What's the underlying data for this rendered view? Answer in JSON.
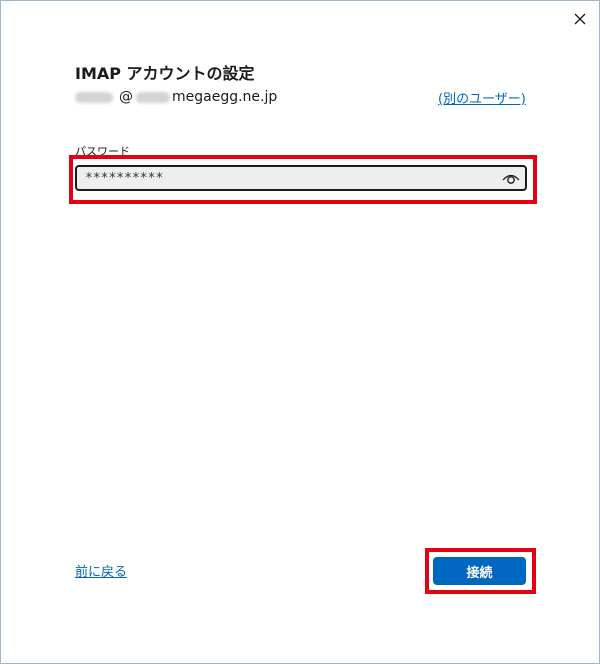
{
  "dialog": {
    "title": "IMAP アカウントの設定",
    "account": {
      "at": "@",
      "domain": "megaegg.ne.jp"
    },
    "other_user_link": "(別のユーザー)",
    "password_label": "パスワード",
    "password_value": "**********",
    "back_link": "前に戻る",
    "connect_button": "接続"
  },
  "colors": {
    "accent": "#0067c0",
    "highlight": "#e60012"
  },
  "icons": {
    "close": "close-icon",
    "reveal": "eye-icon"
  }
}
